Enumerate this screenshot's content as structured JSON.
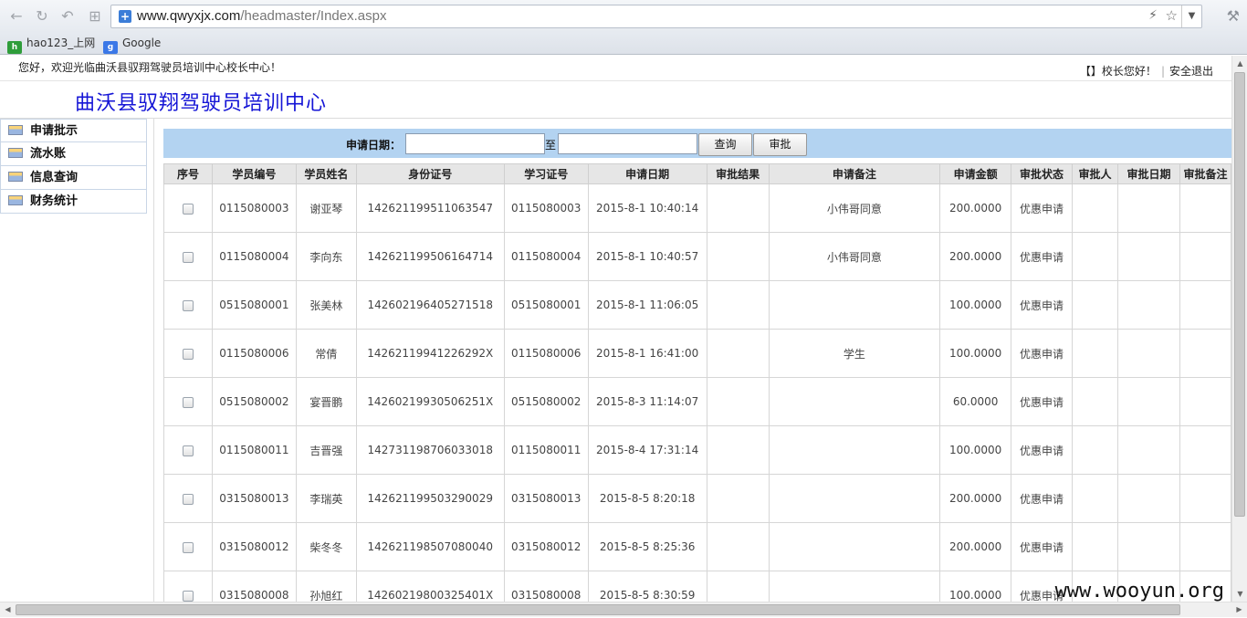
{
  "browser": {
    "url_host": "www.qwyxjx.com",
    "url_path": "/headmaster/Index.aspx",
    "bookmarks": [
      {
        "label": "hao123_上网",
        "icon": "hao123-icon"
      },
      {
        "label": "Google",
        "icon": "google-icon"
      }
    ]
  },
  "header": {
    "welcome": "您好，欢迎光临曲沃县驭翔驾驶员培训中心校长中心！",
    "greeting": "【】校长您好！",
    "logout": "安全退出",
    "site_title": "曲沃县驭翔驾驶员培训中心"
  },
  "sidebar": {
    "items": [
      {
        "label": "申请批示"
      },
      {
        "label": "流水账"
      },
      {
        "label": "信息查询"
      },
      {
        "label": "财务统计"
      }
    ]
  },
  "search": {
    "label": "申请日期：",
    "to_label": "至",
    "start_value": "",
    "end_value": "",
    "query_button": "查询",
    "approve_button": "审批"
  },
  "table": {
    "columns": [
      "序号",
      "学员编号",
      "学员姓名",
      "身份证号",
      "学习证号",
      "申请日期",
      "审批结果",
      "申请备注",
      "申请金额",
      "审批状态",
      "审批人",
      "审批日期",
      "审批备注"
    ],
    "rows": [
      [
        "0115080003",
        "谢亚琴",
        "142621199511063547",
        "0115080003",
        "2015-8-1 10:40:14",
        "",
        "小伟哥同意",
        "200.0000",
        "优惠申请",
        "",
        "",
        ""
      ],
      [
        "0115080004",
        "李向东",
        "142621199506164714",
        "0115080004",
        "2015-8-1 10:40:57",
        "",
        "小伟哥同意",
        "200.0000",
        "优惠申请",
        "",
        "",
        ""
      ],
      [
        "0515080001",
        "张美林",
        "142602196405271518",
        "0515080001",
        "2015-8-1 11:06:05",
        "",
        "",
        "100.0000",
        "优惠申请",
        "",
        "",
        ""
      ],
      [
        "0115080006",
        "常倩",
        "14262119941226292X",
        "0115080006",
        "2015-8-1 16:41:00",
        "",
        "学生",
        "100.0000",
        "优惠申请",
        "",
        "",
        ""
      ],
      [
        "0515080002",
        "宴晋鹏",
        "14260219930506251X",
        "0515080002",
        "2015-8-3 11:14:07",
        "",
        "",
        "60.0000",
        "优惠申请",
        "",
        "",
        ""
      ],
      [
        "0115080011",
        "吉晋强",
        "142731198706033018",
        "0115080011",
        "2015-8-4 17:31:14",
        "",
        "",
        "100.0000",
        "优惠申请",
        "",
        "",
        ""
      ],
      [
        "0315080013",
        "李瑞英",
        "142621199503290029",
        "0315080013",
        "2015-8-5 8:20:18",
        "",
        "",
        "200.0000",
        "优惠申请",
        "",
        "",
        ""
      ],
      [
        "0315080012",
        "柴冬冬",
        "142621198507080040",
        "0315080012",
        "2015-8-5 8:25:36",
        "",
        "",
        "200.0000",
        "优惠申请",
        "",
        "",
        ""
      ],
      [
        "0315080008",
        "孙旭红",
        "14260219800325401X",
        "0315080008",
        "2015-8-5 8:30:59",
        "",
        "",
        "100.0000",
        "优惠申请",
        "",
        "",
        ""
      ]
    ]
  },
  "watermark": "www.wooyun.org"
}
